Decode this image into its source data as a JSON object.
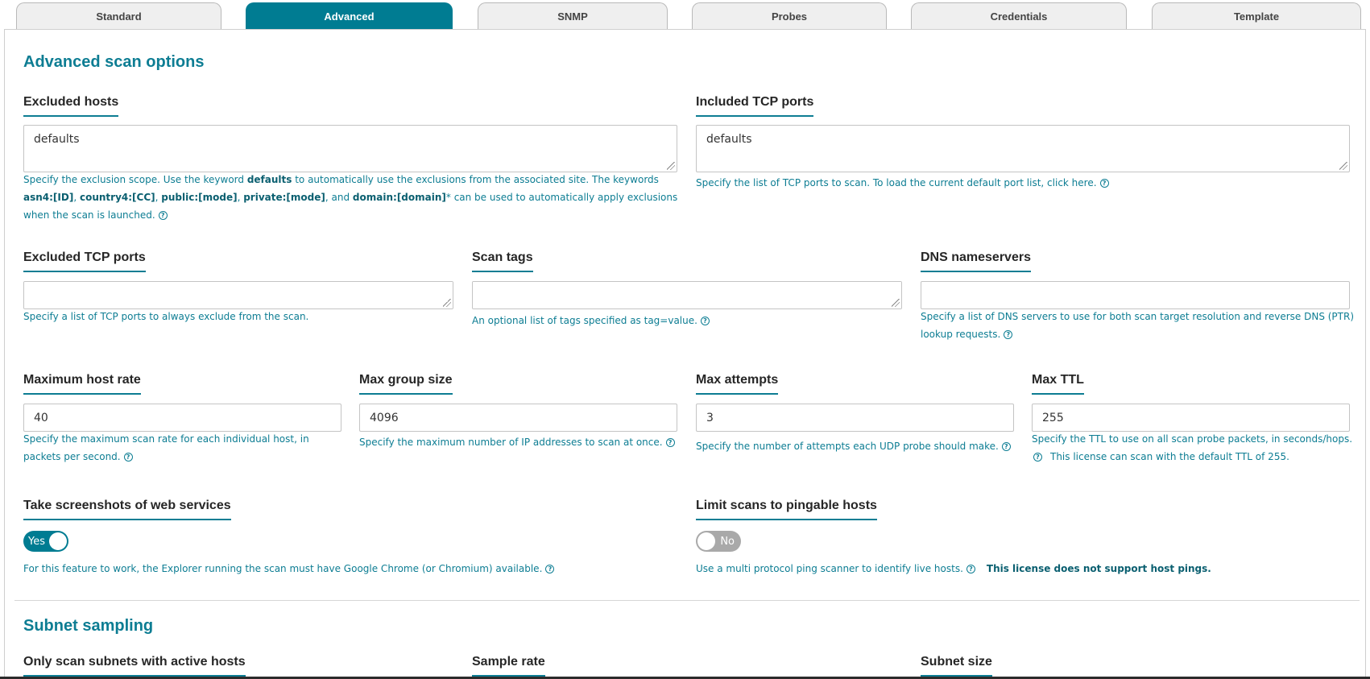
{
  "tabs": [
    "Standard",
    "Advanced",
    "SNMP",
    "Probes",
    "Credentials",
    "Template"
  ],
  "advanced": {
    "title": "Advanced scan options",
    "excluded_hosts": {
      "label": "Excluded hosts",
      "value": "defaults",
      "help_a": "Specify the exclusion scope. Use the keyword ",
      "help_kw1": "defaults",
      "help_b": " to automatically use the exclusions from the associated site. The keywords ",
      "help_kw2": "asn4:[ID]",
      "help_sep1": ", ",
      "help_kw3": "country4:[CC]",
      "help_sep2": ", ",
      "help_kw4": "public:[mode]",
      "help_sep3": ", ",
      "help_kw5": "private:[mode]",
      "help_sep4": ", and ",
      "help_kw6": "domain:[domain]",
      "help_c": "* can be used to automatically apply exclusions when the scan is launched."
    },
    "included_tcp": {
      "label": "Included TCP ports",
      "value": "defaults",
      "help": "Specify the list of TCP ports to scan. To load the current default port list, click here."
    },
    "excluded_tcp": {
      "label": "Excluded TCP ports",
      "value": "",
      "help": "Specify a list of TCP ports to always exclude from the scan."
    },
    "scan_tags": {
      "label": "Scan tags",
      "value": "",
      "help": "An optional list of tags specified as tag=value."
    },
    "dns": {
      "label": "DNS nameservers",
      "value": "",
      "help": "Specify a list of DNS servers to use for both scan target resolution and reverse DNS (PTR) lookup requests."
    },
    "max_host_rate": {
      "label": "Maximum host rate",
      "value": "40",
      "help": "Specify the maximum scan rate for each individual host, in packets per second."
    },
    "max_group_size": {
      "label": "Max group size",
      "value": "4096",
      "help": "Specify the maximum number of IP addresses to scan at once."
    },
    "max_attempts": {
      "label": "Max attempts",
      "value": "3",
      "help": "Specify the number of attempts each UDP probe should make."
    },
    "max_ttl": {
      "label": "Max TTL",
      "value": "255",
      "help": "Specify the TTL to use on all scan probe packets, in seconds/hops.",
      "note": "This license can scan with the default TTL of 255."
    },
    "screenshots": {
      "label": "Take screenshots of web services",
      "toggle": "Yes",
      "help": "For this feature to work, the Explorer running the scan must have Google Chrome (or Chromium) available."
    },
    "pingable": {
      "label": "Limit scans to pingable hosts",
      "toggle": "No",
      "help": "Use a multi protocol ping scanner to identify live hosts.",
      "note": "This license does not support host pings."
    }
  },
  "subnet": {
    "title": "Subnet sampling",
    "active_label": "Only scan subnets with active hosts",
    "sample_rate_label": "Sample rate",
    "subnet_size_label": "Subnet size"
  },
  "colors": {
    "accent": "#007c92",
    "heading": "#0d7d93"
  }
}
